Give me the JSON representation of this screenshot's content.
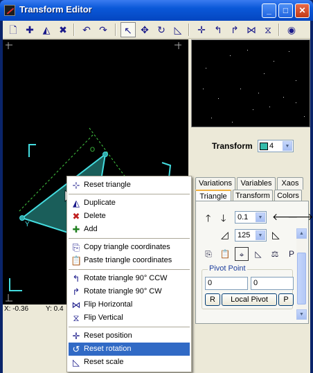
{
  "window": {
    "title": "Transform Editor",
    "buttons": {
      "minimize": "_",
      "maximize": "□",
      "close": "✕"
    }
  },
  "toolbar": {
    "tools": [
      {
        "name": "new-button",
        "glyph": "🗋",
        "active": false
      },
      {
        "name": "add-transform-button",
        "glyph": "✚",
        "active": false
      },
      {
        "name": "duplicate-transform-button",
        "glyph": "◭",
        "active": false
      },
      {
        "name": "delete-transform-button",
        "glyph": "✖",
        "active": false
      },
      {
        "name": "undo-button",
        "glyph": "↶",
        "active": false
      },
      {
        "name": "redo-button",
        "glyph": "↷",
        "active": false
      },
      {
        "name": "select-mode-button",
        "glyph": "↖",
        "active": true
      },
      {
        "name": "move-mode-button",
        "glyph": "✥",
        "active": false
      },
      {
        "name": "rotate-mode-button",
        "glyph": "↻",
        "active": false
      },
      {
        "name": "scale-mode-button",
        "glyph": "◺",
        "active": false
      },
      {
        "name": "reset-position-button",
        "glyph": "✛",
        "active": false
      },
      {
        "name": "rotate-ccw-button",
        "glyph": "↰",
        "active": false
      },
      {
        "name": "rotate-cw-button",
        "glyph": "↱",
        "active": false
      },
      {
        "name": "flip-horizontal-button",
        "glyph": "⋈",
        "active": false
      },
      {
        "name": "flip-vertical-button",
        "glyph": "⧖",
        "active": false
      },
      {
        "name": "view-options-button",
        "glyph": "◉",
        "active": false
      }
    ]
  },
  "status": {
    "x": "X: -0.36",
    "y": "Y: 0.4"
  },
  "panel": {
    "transform_label": "Transform",
    "transform_value": "4",
    "tabs_top": [
      "Variations",
      "Variables",
      "Xaos"
    ],
    "tabs_bottom": [
      "Triangle",
      "Transform",
      "Colors"
    ],
    "selected_tab": "Triangle",
    "step_value": "0.1",
    "angle_value": "125",
    "pivot_group": "Pivot Point",
    "pivot_x": "0",
    "pivot_y": "0",
    "pivot_r": "R",
    "pivot_local": "Local Pivot",
    "pivot_p": "P"
  },
  "context_menu": {
    "items": [
      {
        "label": "Reset triangle",
        "icon": "reset-triangle-icon",
        "highlight": false
      },
      {
        "sep": true
      },
      {
        "label": "Duplicate",
        "icon": "duplicate-icon",
        "highlight": false
      },
      {
        "label": "Delete",
        "icon": "delete-icon",
        "highlight": false
      },
      {
        "label": "Add",
        "icon": "add-icon",
        "highlight": false
      },
      {
        "sep": true
      },
      {
        "label": "Copy triangle coordinates",
        "icon": "copy-icon",
        "highlight": false
      },
      {
        "label": "Paste triangle coordinates",
        "icon": "paste-icon",
        "highlight": false
      },
      {
        "sep": true
      },
      {
        "label": "Rotate triangle 90° CCW",
        "icon": "rotate-ccw-icon",
        "highlight": false
      },
      {
        "label": "Rotate triangle 90° CW",
        "icon": "rotate-cw-icon",
        "highlight": false
      },
      {
        "label": "Flip Horizontal",
        "icon": "flip-horizontal-icon",
        "highlight": false
      },
      {
        "label": "Flip Vertical",
        "icon": "flip-vertical-icon",
        "highlight": false
      },
      {
        "sep": true
      },
      {
        "label": "Reset position",
        "icon": "reset-position-icon",
        "highlight": false
      },
      {
        "label": "Reset rotation",
        "icon": "reset-rotation-icon",
        "highlight": true
      },
      {
        "label": "Reset scale",
        "icon": "reset-scale-icon",
        "highlight": false
      }
    ]
  },
  "colors": {
    "triangle_fill": "#1a5e5a",
    "triangle_stroke": "#44dde0",
    "axis": "#44cc44",
    "highlight": "#316ac5"
  }
}
